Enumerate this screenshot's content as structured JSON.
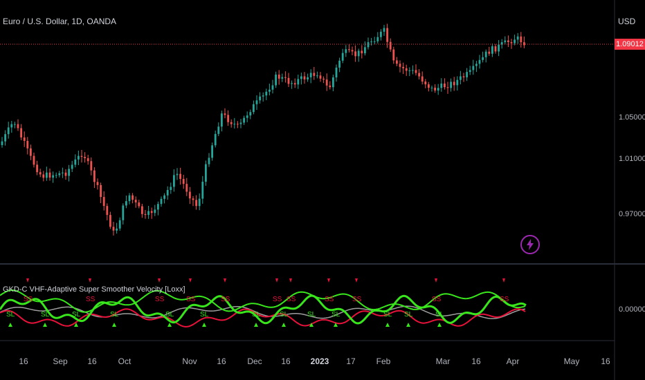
{
  "header": {
    "symbol_title": "Euro / U.S. Dollar, 1D, OANDA",
    "currency": "USD",
    "last_price": "1.09012"
  },
  "indicator": {
    "title": "GKD-C VHF-Adaptive Super Smoother Velocity [Loxx]",
    "zero_label": "0.00000"
  },
  "price_axis": [
    "1.05000",
    "1.01000",
    "0.97000"
  ],
  "time_axis": [
    {
      "label": "16",
      "bold": false
    },
    {
      "label": "Sep",
      "bold": false
    },
    {
      "label": "16",
      "bold": false
    },
    {
      "label": "Oct",
      "bold": false
    },
    {
      "label": "Nov",
      "bold": false
    },
    {
      "label": "16",
      "bold": false
    },
    {
      "label": "Dec",
      "bold": false
    },
    {
      "label": "16",
      "bold": false
    },
    {
      "label": "2023",
      "bold": true
    },
    {
      "label": "17",
      "bold": false
    },
    {
      "label": "Feb",
      "bold": false
    },
    {
      "label": "Mar",
      "bold": false
    },
    {
      "label": "16",
      "bold": false
    },
    {
      "label": "Apr",
      "bold": false
    },
    {
      "label": "May",
      "bold": false
    },
    {
      "label": "16",
      "bold": false
    }
  ],
  "colors": {
    "up": "#26a69a",
    "down": "#ef5350",
    "fast_up": "#39e61c",
    "fast_down": "#e8123a",
    "slow": "#9e9e9e",
    "price_line": "#f23645",
    "accent": "#9c27b0"
  },
  "signals": {
    "short_label": "SS",
    "long_label": "SL"
  },
  "icons": {
    "alert": "lightning-bolt-icon"
  }
}
